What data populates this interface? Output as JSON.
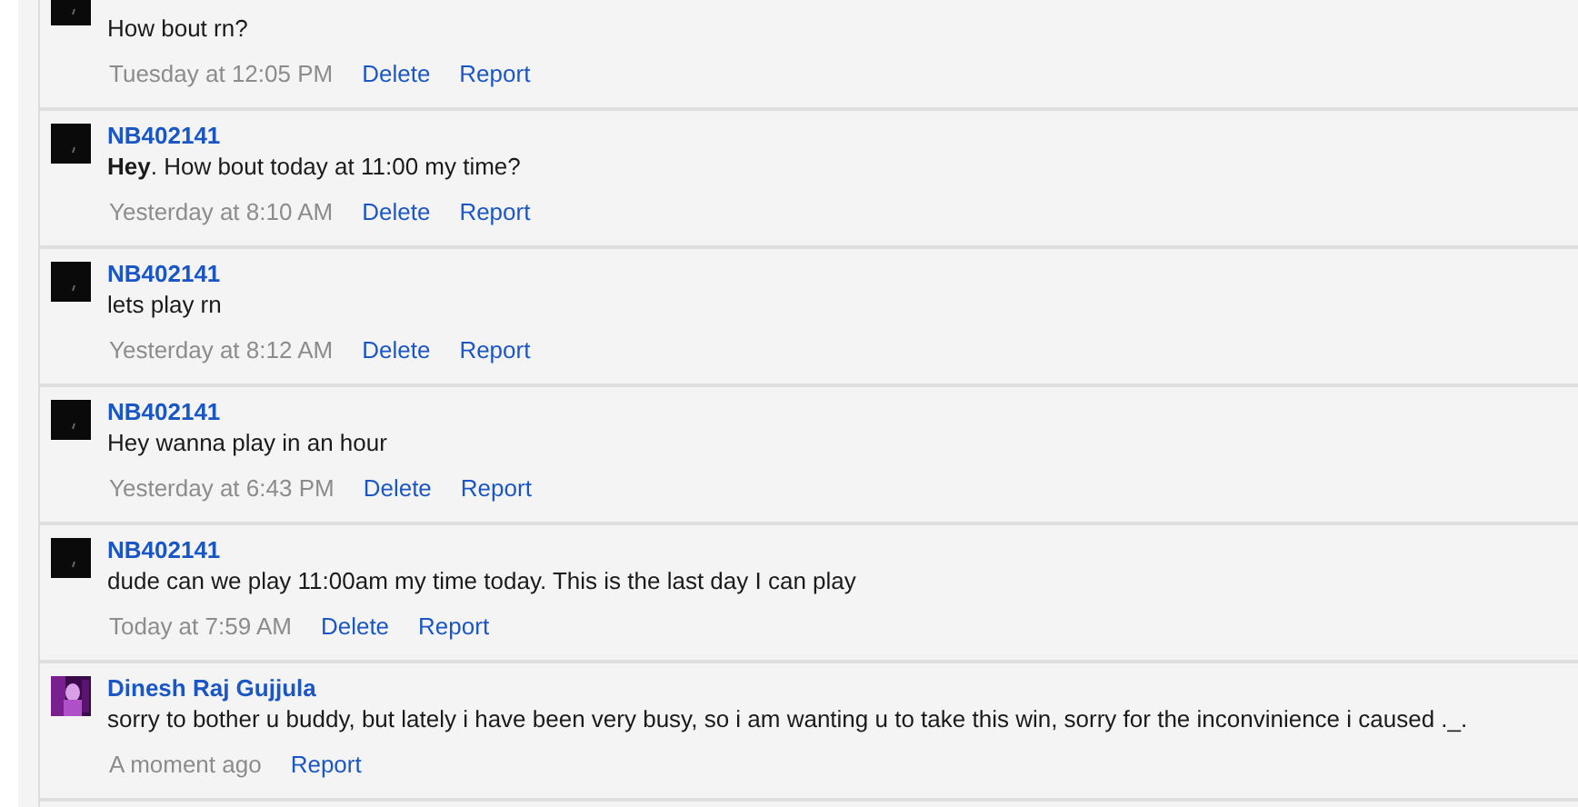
{
  "messages": [
    {
      "kind": "dark",
      "body": "How bout rn?",
      "time": "Tuesday at 12:05 PM",
      "actions": [
        "Delete",
        "Report"
      ]
    },
    {
      "author": "NB402141",
      "kind": "dark",
      "body": "**Hey**. How bout today at 11:00 my time?",
      "time": "Yesterday at 8:10 AM",
      "actions": [
        "Delete",
        "Report"
      ]
    },
    {
      "author": "NB402141",
      "kind": "dark",
      "body": "lets play rn",
      "time": "Yesterday at 8:12 AM",
      "actions": [
        "Delete",
        "Report"
      ]
    },
    {
      "author": "NB402141",
      "kind": "dark",
      "body": "Hey wanna play in an hour",
      "time": "Yesterday at 6:43 PM",
      "actions": [
        "Delete",
        "Report"
      ]
    },
    {
      "author": "NB402141",
      "kind": "dark",
      "body": "dude can we play 11:00am my time today. This is the last day I can play",
      "time": "Today at 7:59 AM",
      "actions": [
        "Delete",
        "Report"
      ]
    },
    {
      "author": "Dinesh Raj Gujjula",
      "body": "sorry to bother u buddy, but lately i have been very busy, so i am wanting u to take this win, sorry for the inconvinience i caused ._.",
      "time": "A moment ago",
      "actions": [
        "Report"
      ]
    }
  ]
}
